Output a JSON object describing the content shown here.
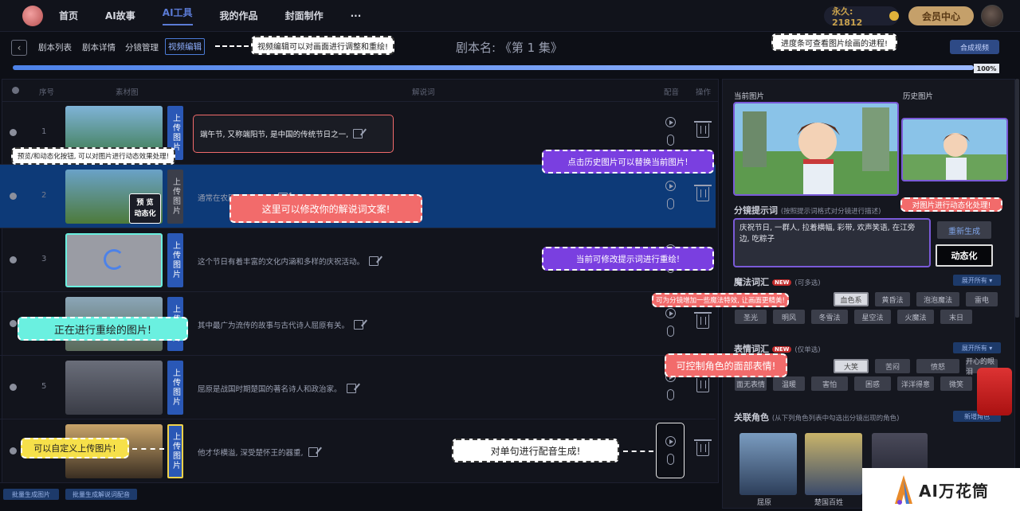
{
  "nav": {
    "items": [
      "首页",
      "AI故事",
      "AI工具",
      "我的作品",
      "封面制作",
      "···"
    ],
    "active_index": 2,
    "points": "永久: 21812",
    "member_label": "会员中心"
  },
  "toolbar": {
    "tabs": [
      "剧本列表",
      "剧本详情",
      "分镜管理",
      "视频编辑"
    ],
    "script_title": "剧本名: 《第 1 集》",
    "compose_label": "合成视频",
    "preview_label": "进度条可查看图片绘画的进程!"
  },
  "progress": {
    "value": 100,
    "label": "100%"
  },
  "table": {
    "headers": [
      "序号",
      "素材图",
      "解说词",
      "配音",
      "操作"
    ],
    "upload_label": "上传图片",
    "preview_label": "预 览",
    "animate_label": "动态化",
    "rows": [
      {
        "num": "1",
        "text": "端午节, 又称端阳节, 是中国的传统节日之一,",
        "selected": false
      },
      {
        "num": "2",
        "text": "通常在农历五月初五...",
        "selected": true
      },
      {
        "num": "3",
        "text": "这个节日有着丰富的文化内涵和多样的庆祝活动。",
        "selected": false
      },
      {
        "num": "4",
        "text": "其中最广为流传的故事与古代诗人屈原有关。",
        "selected": false
      },
      {
        "num": "5",
        "text": "屈原是战国时期楚国的著名诗人和政治家。",
        "selected": false
      },
      {
        "num": "6",
        "text": "他才华横溢, 深受楚怀王的器重,",
        "selected": false
      }
    ],
    "batch_image_label": "批量生成图片",
    "batch_voice_label": "批量生成解说词配音"
  },
  "right": {
    "current_label": "当前图片",
    "history_label": "历史图片",
    "prompt_title": "分镜提示词",
    "prompt_hint": "(按照提示词格式对分镜进行描述)",
    "prompt_text": "庆祝节日, 一群人, 拉着横幅, 彩带, 欢声笑语, 在江旁边, 吃粽子",
    "regen_label": "重新生成",
    "animate_label": "动态化",
    "magic_title": "魔法词汇",
    "magic_hint": "(可多选)",
    "new_badge": "NEW",
    "expand_label": "展开所有 ▾",
    "magic_tags": [
      "血色系",
      "黄昏法",
      "泡泡魔法",
      "雷电",
      "圣光",
      "明风",
      "冬雪法",
      "星空法",
      "火魔法",
      "末日"
    ],
    "emotion_title": "表情词汇",
    "emotion_hint": "(仅单选)",
    "emotion_tags": [
      "大笑",
      "苦闷",
      "愤怒",
      "开心的眼泪",
      "面无表情",
      "温暖",
      "害怕",
      "困惑",
      "洋洋得意",
      "微笑"
    ],
    "role_title": "关联角色",
    "role_hint": "(从下列角色列表中勾选出分镜出现的角色)",
    "new_role_label": "新增角色",
    "roles": [
      "屈原",
      "楚国百姓"
    ]
  },
  "notes": {
    "video_edit": "视频编辑可以对画面进行调整和重绘!",
    "progress": "进度条可查看图片绘画的进程!",
    "preview_animate": "预览/和动态化按钮, 可以对图片进行动态效果处理!",
    "edit_narration": "这里可以修改你的解说词文案!",
    "history_replace": "点击历史图片可以替换当前图片!",
    "animate_image": "对图片进行动态化处理!",
    "modify_prompt": "当前可修改提示词进行重绘!",
    "magic_effect": "可为分镜增加一些魔法特效, 让画面更精美!",
    "redrawing": "正在进行重绘的图片!",
    "expression": "可控制角色的面部表情!",
    "custom_upload": "可以自定义上传图片!",
    "single_voice": "对单句进行配音生成!"
  },
  "watermark": "AI万花筒",
  "colors": {
    "accent": "#5b7bd6",
    "purple": "#7a3fe0",
    "red_note": "#f26b6b",
    "selected_row": "#0d3a78"
  }
}
